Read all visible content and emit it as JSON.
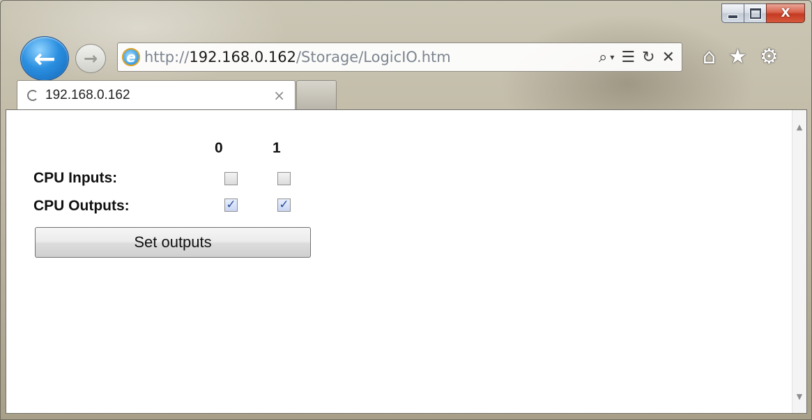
{
  "window": {
    "caption_buttons": {
      "minimize_icon": "minimize-icon",
      "maximize_icon": "maximize-icon",
      "close_label": "X"
    }
  },
  "navigation": {
    "back_icon": "back-arrow-icon",
    "forward_icon": "forward-arrow-icon",
    "url_scheme": "http://",
    "url_host": "192.168.0.162",
    "url_path": "/Storage/LogicIO.htm",
    "address_icons": [
      "search-icon",
      "dropdown-icon",
      "compatibility-icon",
      "refresh-icon",
      "stop-icon"
    ],
    "toolbar_icons": [
      "home-icon",
      "favorites-icon",
      "settings-icon"
    ]
  },
  "tabs": [
    {
      "title": "192.168.0.162",
      "close_label": "×",
      "loading": true
    }
  ],
  "page": {
    "columns": [
      "0",
      "1"
    ],
    "inputs_label": "CPU Inputs:",
    "outputs_label": "CPU Outputs:",
    "inputs": [
      false,
      false
    ],
    "outputs": [
      true,
      true
    ],
    "set_outputs_label": "Set outputs"
  },
  "colors": {
    "accent": "#2b8fe0",
    "close": "#c43a22",
    "checkmark": "#2b4b9a"
  }
}
